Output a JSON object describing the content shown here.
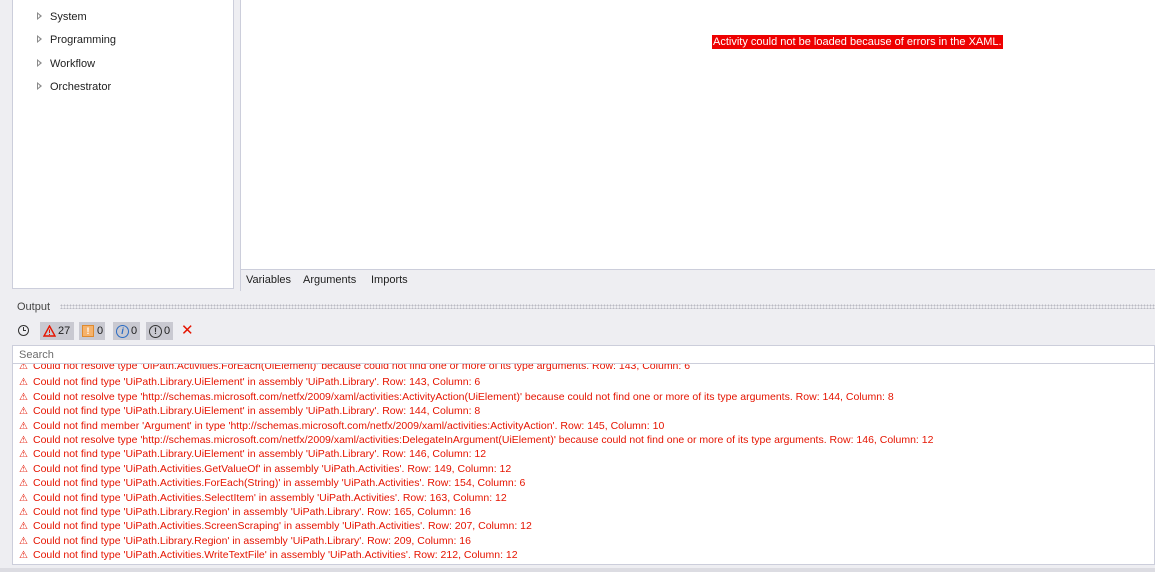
{
  "activities": {
    "items": [
      {
        "label": "System"
      },
      {
        "label": "Programming"
      },
      {
        "label": "Workflow"
      },
      {
        "label": "Orchestrator"
      }
    ]
  },
  "designer": {
    "error_text": "Activity could not be loaded because of errors in the XAML.",
    "error_color": "#ee0000",
    "tabs": [
      {
        "label": "Variables"
      },
      {
        "label": "Arguments"
      },
      {
        "label": "Imports"
      }
    ]
  },
  "output": {
    "title": "Output",
    "filters": {
      "errors": "27",
      "warnings": "0",
      "info": "0",
      "trace": "0"
    },
    "search_placeholder": "Search",
    "error_color": "#e51400",
    "log_lines": [
      "Could not resolve type 'UiPath.Activities.ForEach(UiElement)' because could not find one or more of its type arguments. Row: 143, Column: 6",
      "Could not find type 'UiPath.Library.UiElement' in assembly 'UiPath.Library'. Row: 143, Column: 6",
      "Could not resolve type 'http://schemas.microsoft.com/netfx/2009/xaml/activities:ActivityAction(UiElement)' because could not find one or more of its type arguments. Row: 144, Column: 8",
      "Could not find type 'UiPath.Library.UiElement' in assembly 'UiPath.Library'. Row: 144, Column: 8",
      "Could not find member 'Argument' in type 'http://schemas.microsoft.com/netfx/2009/xaml/activities:ActivityAction'. Row: 145, Column: 10",
      "Could not resolve type 'http://schemas.microsoft.com/netfx/2009/xaml/activities:DelegateInArgument(UiElement)' because could not find one or more of its type arguments. Row: 146, Column: 12",
      "Could not find type 'UiPath.Library.UiElement' in assembly 'UiPath.Library'. Row: 146, Column: 12",
      "Could not find type 'UiPath.Activities.GetValueOf' in assembly 'UiPath.Activities'. Row: 149, Column: 12",
      "Could not find type 'UiPath.Activities.ForEach(String)' in assembly 'UiPath.Activities'. Row: 154, Column: 6",
      "Could not find type 'UiPath.Activities.SelectItem' in assembly 'UiPath.Activities'. Row: 163, Column: 12",
      "Could not find type 'UiPath.Library.Region' in assembly 'UiPath.Library'. Row: 165, Column: 16",
      "Could not find type 'UiPath.Activities.ScreenScraping' in assembly 'UiPath.Activities'. Row: 207, Column: 12",
      "Could not find type 'UiPath.Library.Region' in assembly 'UiPath.Library'. Row: 209, Column: 16",
      "Could not find type 'UiPath.Activities.WriteTextFile' in assembly 'UiPath.Activities'. Row: 212, Column: 12"
    ]
  }
}
